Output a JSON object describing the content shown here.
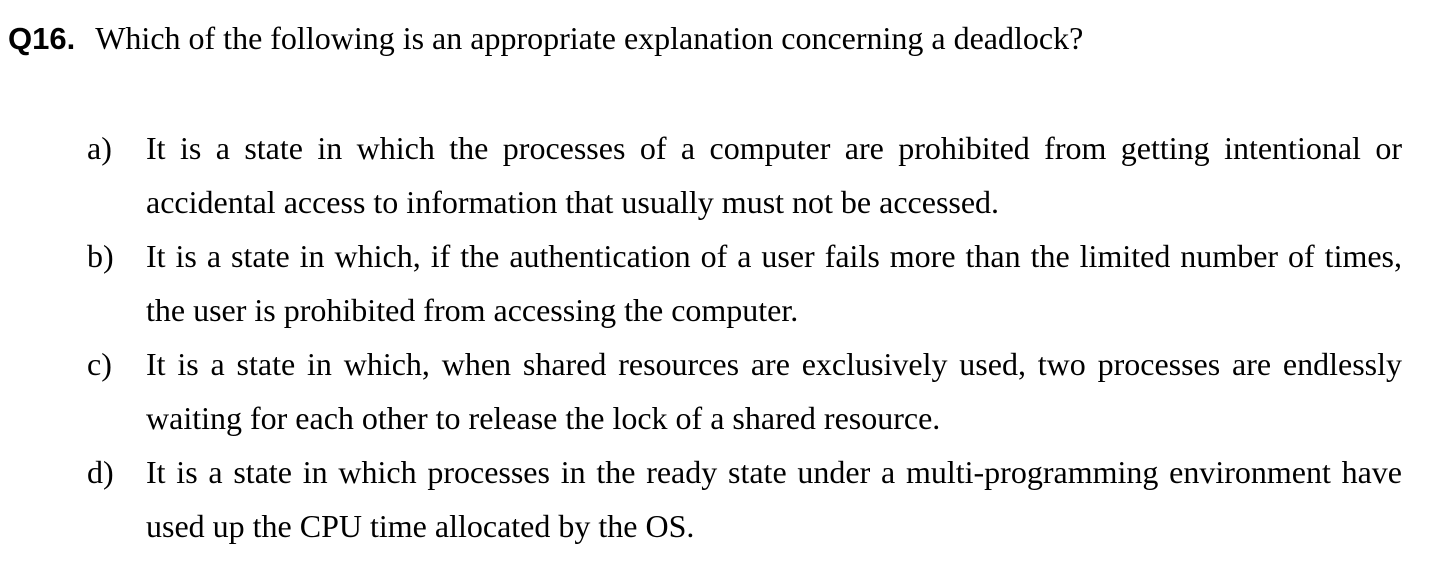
{
  "question": {
    "number": "Q16.",
    "text": "Which of the following is an appropriate explanation concerning a deadlock?"
  },
  "options": [
    {
      "letter": "a)",
      "text": "It is a state in which the processes of a computer are prohibited from getting intentional or accidental access to information that usually must not be accessed."
    },
    {
      "letter": "b)",
      "text": "It is a state in which, if the authentication of a user fails more than the limited number of times, the user is prohibited from accessing the computer."
    },
    {
      "letter": "c)",
      "text": "It is a state in which, when shared resources are exclusively used, two processes are endlessly waiting for each other to release the lock of a shared resource."
    },
    {
      "letter": "d)",
      "text": "It is a state in which processes in the ready state under a multi-programming environment have used up the CPU time allocated by the OS."
    }
  ]
}
